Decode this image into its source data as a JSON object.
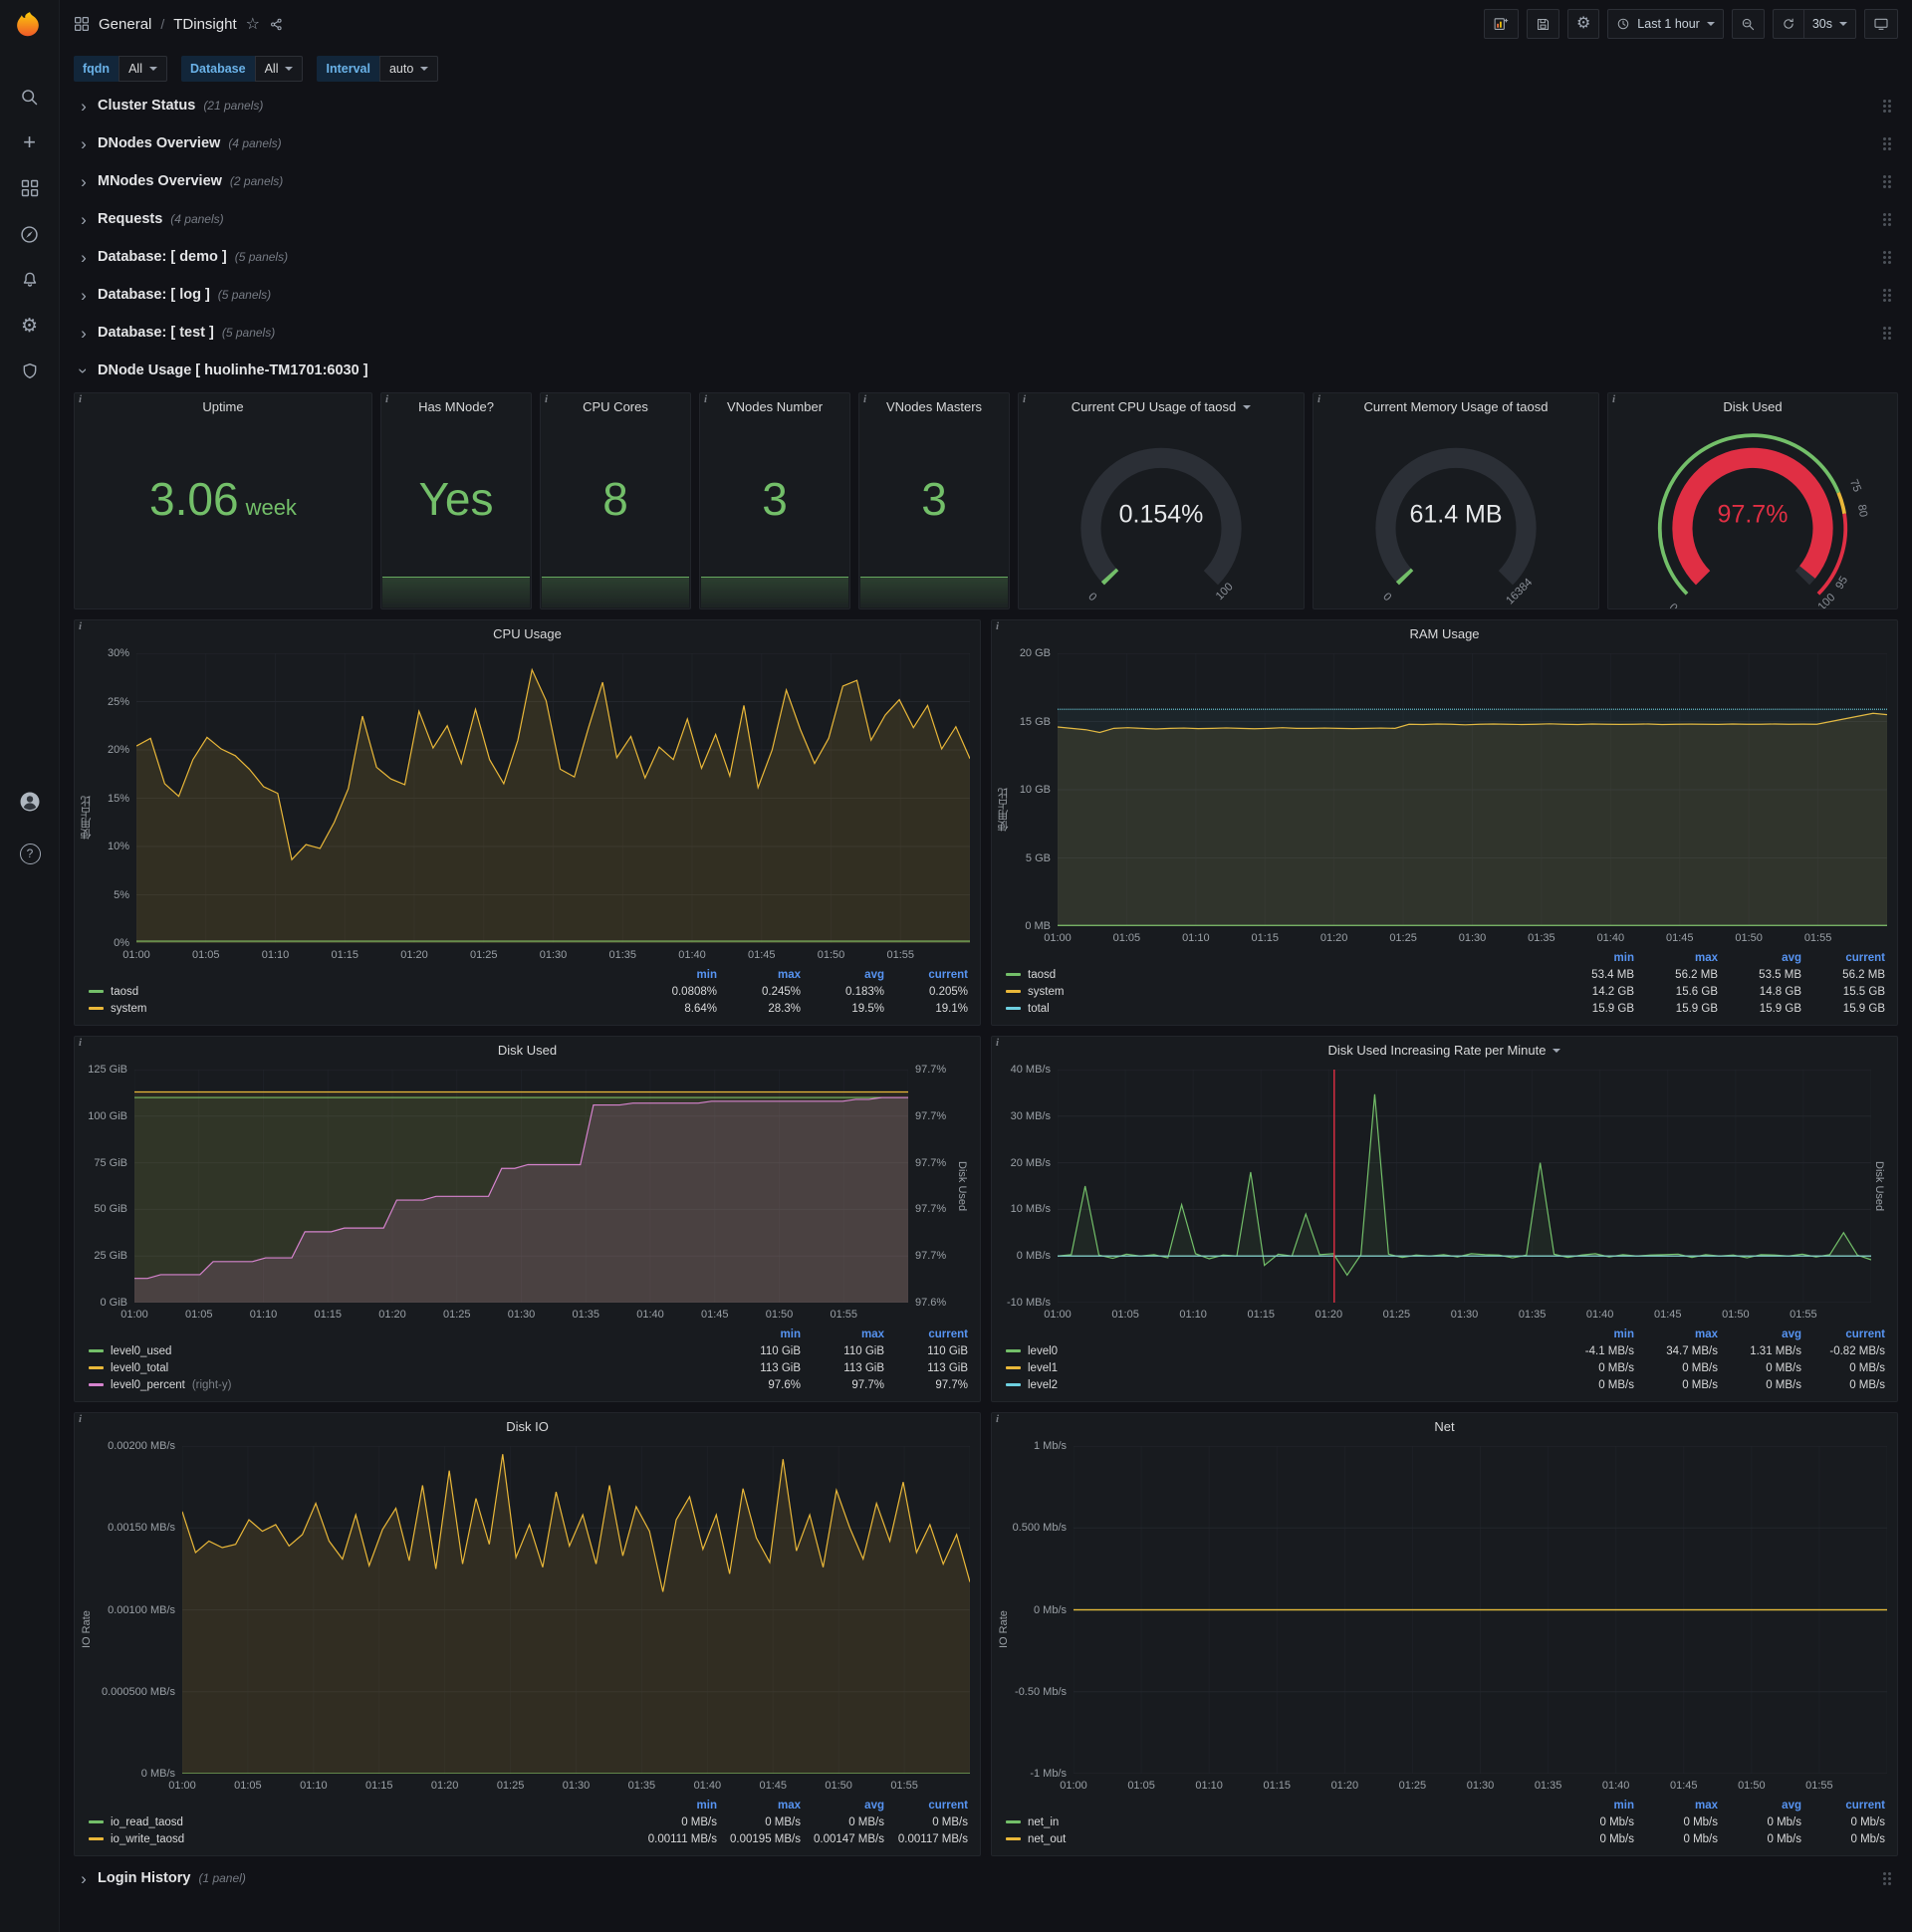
{
  "theme": {
    "page_bg": "#111217",
    "panel_bg": "#181b1f",
    "green": "#73bf69",
    "yellow": "#eab839",
    "cyan": "#6ed0e0",
    "pink": "#d683ce",
    "red": "#e02f44",
    "legend_header_blue": "#5794f2",
    "variable_label_blue": "#6ab2e8"
  },
  "icons": {
    "gear": "⚙",
    "star": "☆",
    "plus": "+",
    "help": "?",
    "chevron": "›",
    "info": "i"
  },
  "nav": {
    "section": "General",
    "separator": "/",
    "page": "TDinsight",
    "time_range": "Last 1 hour",
    "refresh_interval": "30s"
  },
  "variables": [
    {
      "label": "fqdn",
      "value": "All"
    },
    {
      "label": "Database",
      "value": "All"
    },
    {
      "label": "Interval",
      "value": "auto"
    }
  ],
  "rows": [
    {
      "title": "Cluster Status",
      "count": "(21 panels)"
    },
    {
      "title": "DNodes Overview",
      "count": "(4 panels)"
    },
    {
      "title": "MNodes Overview",
      "count": "(2 panels)"
    },
    {
      "title": "Requests",
      "count": "(4 panels)"
    },
    {
      "title": "Database: [ demo ]",
      "count": "(5 panels)"
    },
    {
      "title": "Database: [ log ]",
      "count": "(5 panels)"
    },
    {
      "title": "Database: [ test ]",
      "count": "(5 panels)"
    }
  ],
  "expanded_row": {
    "title": "DNode Usage [ huolinhe-TM1701:6030 ]"
  },
  "login_row": {
    "title": "Login History",
    "count": "(1 panel)"
  },
  "time_ticks": [
    "01:00",
    "01:05",
    "01:10",
    "01:15",
    "01:20",
    "01:25",
    "01:30",
    "01:35",
    "01:40",
    "01:45",
    "01:50",
    "01:55"
  ],
  "stats": [
    {
      "type": "stat",
      "title": "Uptime",
      "value": "3.06",
      "unit": "week",
      "spark": false
    },
    {
      "type": "stat",
      "title": "Has MNode?",
      "value": "Yes",
      "spark": true
    },
    {
      "type": "stat",
      "title": "CPU Cores",
      "value": "8",
      "spark": true
    },
    {
      "type": "stat",
      "title": "VNodes Number",
      "value": "3",
      "spark": true
    },
    {
      "type": "stat",
      "title": "VNodes Masters",
      "value": "3",
      "spark": true
    },
    {
      "type": "gauge",
      "title": "Current CPU Usage of taosd",
      "caret": true,
      "value": "0.154%",
      "frac": 0.0015,
      "color": "#73bf69",
      "labels": [
        {
          "text": "0",
          "f": 0
        },
        {
          "text": "100",
          "f": 1
        }
      ]
    },
    {
      "type": "gauge",
      "title": "Current Memory Usage of taosd",
      "value": "61.4 MB",
      "frac": 0.0037,
      "color": "#73bf69",
      "labels": [
        {
          "text": "0",
          "f": 0
        },
        {
          "text": "16384",
          "f": 1
        }
      ]
    },
    {
      "type": "gauge",
      "title": "Disk Used",
      "value": "97.7%",
      "frac": 0.977,
      "color": "#e02f44",
      "value_color": "#e02f44",
      "labels": [
        {
          "text": "0",
          "f": 0
        },
        {
          "text": "75",
          "f": 0.75
        },
        {
          "text": "80",
          "f": 0.8
        },
        {
          "text": "95",
          "f": 0.95
        },
        {
          "text": "100",
          "f": 1
        }
      ],
      "ring": [
        {
          "from": 0,
          "to": 0.75,
          "color": "#73bf69"
        },
        {
          "from": 0.75,
          "to": 0.8,
          "color": "#eab839"
        },
        {
          "from": 0.8,
          "to": 1,
          "color": "#e02f44"
        }
      ]
    }
  ],
  "charts": [
    {
      "type": "line",
      "title": "CPU Usage",
      "y_label": "使用占比",
      "ymin": 0,
      "ymax": 30,
      "y_ticks": [
        "30%",
        "25%",
        "20%",
        "15%",
        "10%",
        "5%",
        "0%"
      ],
      "legend_cols": [
        "min",
        "max",
        "avg",
        "current"
      ],
      "series": [
        {
          "name": "taosd",
          "color": "#73bf69",
          "fill": true,
          "fill_opacity": 0.08,
          "values": [
            0.2,
            0.2
          ],
          "legend": [
            "0.0808%",
            "0.245%",
            "0.183%",
            "0.205%"
          ]
        },
        {
          "name": "system",
          "color": "#eab839",
          "fill": true,
          "fill_opacity": 0.13,
          "values": [
            20.4,
            21.2,
            16.5,
            15.2,
            19.0,
            21.3,
            20.1,
            19.4,
            18.0,
            16.2,
            15.5,
            8.64,
            10.2,
            9.8,
            12.5,
            16.0,
            23.5,
            18.2,
            17.0,
            16.4,
            24.0,
            20.2,
            22.5,
            18.6,
            24.2,
            19.0,
            16.5,
            21.0,
            28.3,
            25.1,
            18.0,
            17.2,
            22.3,
            27.0,
            19.2,
            21.4,
            17.1,
            20.3,
            19.0,
            23.2,
            18.1,
            21.6,
            17.3,
            24.6,
            16.1,
            20.0,
            26.2,
            22.1,
            18.6,
            21.2,
            26.6,
            27.2,
            21.0,
            23.6,
            25.2,
            22.3,
            24.6,
            20.1,
            22.4,
            19.1
          ],
          "legend": [
            "8.64%",
            "28.3%",
            "19.5%",
            "19.1%"
          ]
        }
      ]
    },
    {
      "type": "line",
      "title": "RAM Usage",
      "y_label": "使用占比",
      "ymin": 0,
      "ymax": 20,
      "y_ticks": [
        "20 GB",
        "15 GB",
        "10 GB",
        "5 GB",
        "0 MB"
      ],
      "legend_cols": [
        "min",
        "max",
        "avg",
        "current"
      ],
      "series": [
        {
          "name": "taosd",
          "color": "#73bf69",
          "fill": true,
          "fill_opacity": 0.08,
          "values": [
            0.053,
            0.053
          ],
          "legend": [
            "53.4 MB",
            "56.2 MB",
            "53.5 MB",
            "56.2 MB"
          ]
        },
        {
          "name": "system",
          "color": "#eab839",
          "fill": true,
          "fill_opacity": 0.1,
          "values": [
            14.6,
            14.5,
            14.4,
            14.2,
            14.5,
            14.55,
            14.5,
            14.45,
            14.5,
            14.52,
            14.48,
            14.5,
            14.53,
            14.5,
            14.47,
            14.5,
            14.55,
            14.5,
            14.5,
            14.52,
            14.5,
            14.48,
            14.5,
            14.52,
            14.5,
            14.8,
            14.78,
            14.82,
            14.8,
            14.76,
            14.8,
            14.82,
            14.8,
            14.78,
            14.8,
            14.83,
            14.8,
            14.78,
            14.82,
            14.8,
            14.79,
            14.8,
            14.82,
            14.78,
            14.8,
            14.81,
            14.8,
            14.79,
            14.82,
            14.8,
            14.8,
            14.82,
            14.8,
            14.81,
            14.8,
            15.0,
            15.2,
            15.4,
            15.6,
            15.5
          ],
          "legend": [
            "14.2 GB",
            "15.6 GB",
            "14.8 GB",
            "15.5 GB"
          ]
        },
        {
          "name": "total",
          "color": "#6ed0e0",
          "fill": true,
          "fill_opacity": 0.06,
          "dash": true,
          "values": [
            15.9,
            15.9
          ],
          "legend": [
            "15.9 GB",
            "15.9 GB",
            "15.9 GB",
            "15.9 GB"
          ]
        }
      ]
    },
    {
      "type": "line",
      "title": "Disk Used",
      "ymin": 0,
      "ymax": 125,
      "y_ticks": [
        "125 GiB",
        "100 GiB",
        "75 GiB",
        "50 GiB",
        "25 GiB",
        "0 GiB"
      ],
      "right_ticks": [
        "97.7%",
        "97.7%",
        "97.7%",
        "97.7%",
        "97.7%",
        "97.6%"
      ],
      "right_label": "Disk Used",
      "legend_cols": [
        "min",
        "max",
        "current"
      ],
      "series": [
        {
          "name": "level0_used",
          "color": "#73bf69",
          "fill": true,
          "fill_opacity": 0.1,
          "values": [
            110,
            110
          ],
          "legend": [
            "110 GiB",
            "110 GiB",
            "110 GiB"
          ]
        },
        {
          "name": "level0_total",
          "color": "#eab839",
          "fill": true,
          "fill_opacity": 0.08,
          "values": [
            113,
            113
          ],
          "legend": [
            "113 GiB",
            "113 GiB",
            "113 GiB"
          ]
        },
        {
          "name": "level0_percent",
          "note": "(right-y)",
          "color": "#d683ce",
          "fill": true,
          "fill_opacity": 0.16,
          "values": [
            13,
            13,
            15,
            15,
            15,
            15,
            22,
            22,
            22,
            22,
            24,
            24,
            24,
            38,
            38,
            38,
            40,
            40,
            40,
            40,
            55,
            55,
            55,
            57,
            57,
            57,
            57,
            57,
            72,
            72,
            74,
            74,
            74,
            74,
            74,
            106,
            106,
            106,
            107,
            107,
            107,
            107,
            107,
            107,
            108,
            108,
            108,
            108,
            108,
            108,
            108,
            108,
            108,
            108,
            108,
            109,
            109,
            110,
            110,
            110
          ],
          "legend": [
            "97.6%",
            "97.7%",
            "97.7%"
          ]
        }
      ]
    },
    {
      "type": "line",
      "title": "Disk Used Increasing Rate per Minute",
      "caret": true,
      "ymin": -10,
      "ymax": 40,
      "y_ticks": [
        "40 MB/s",
        "30 MB/s",
        "20 MB/s",
        "10 MB/s",
        "0 MB/s",
        "-10 MB/s"
      ],
      "right_label": "Disk Used",
      "annotation": {
        "x_frac": 0.34,
        "color": "#e02f44"
      },
      "legend_cols": [
        "min",
        "max",
        "avg",
        "current"
      ],
      "series": [
        {
          "name": "level0",
          "color": "#73bf69",
          "fill": true,
          "fill_opacity": 0.08,
          "values": [
            0,
            0.3,
            15,
            0.2,
            -0.5,
            0.4,
            0,
            0.3,
            -0.4,
            11,
            0.5,
            -0.6,
            0.2,
            0,
            18,
            -2,
            0.4,
            0,
            9,
            0.3,
            0.5,
            -4.1,
            0.3,
            34.7,
            0.4,
            -0.3,
            0.2,
            0,
            0.3,
            -0.2,
            0.5,
            0.3,
            0.2,
            -0.4,
            0.2,
            20,
            0.4,
            -0.3,
            0.2,
            0.5,
            -0.2,
            0.3,
            0,
            0.2,
            0.3,
            0.4,
            -0.3,
            0.3,
            0,
            0.2,
            -0.4,
            0.3,
            0.2,
            0,
            0.4,
            -0.2,
            0.3,
            5,
            0.2,
            -0.82
          ],
          "legend": [
            "-4.1 MB/s",
            "34.7 MB/s",
            "1.31 MB/s",
            "-0.82 MB/s"
          ]
        },
        {
          "name": "level1",
          "color": "#eab839",
          "fill": false,
          "values": [
            0,
            0
          ],
          "legend": [
            "0 MB/s",
            "0 MB/s",
            "0 MB/s",
            "0 MB/s"
          ]
        },
        {
          "name": "level2",
          "color": "#6ed0e0",
          "fill": false,
          "values": [
            0,
            0
          ],
          "legend": [
            "0 MB/s",
            "0 MB/s",
            "0 MB/s",
            "0 MB/s"
          ]
        }
      ]
    },
    {
      "type": "line",
      "title": "Disk IO",
      "y_label": "IO Rate",
      "ymin": 0,
      "ymax": 0.002,
      "y_ticks": [
        "0.00200 MB/s",
        "0.00150 MB/s",
        "0.00100 MB/s",
        "0.000500 MB/s",
        "0 MB/s"
      ],
      "legend_cols": [
        "min",
        "max",
        "avg",
        "current"
      ],
      "series": [
        {
          "name": "io_read_taosd",
          "color": "#73bf69",
          "fill": false,
          "values": [
            0,
            0
          ],
          "legend": [
            "0 MB/s",
            "0 MB/s",
            "0 MB/s",
            "0 MB/s"
          ]
        },
        {
          "name": "io_write_taosd",
          "color": "#eab839",
          "fill": true,
          "fill_opacity": 0.12,
          "values": [
            0.0016,
            0.00135,
            0.00142,
            0.00138,
            0.0014,
            0.00155,
            0.00148,
            0.00152,
            0.00139,
            0.00146,
            0.00165,
            0.00142,
            0.00131,
            0.00158,
            0.00127,
            0.00149,
            0.00162,
            0.0013,
            0.00176,
            0.00125,
            0.00185,
            0.00128,
            0.00168,
            0.0014,
            0.00195,
            0.00132,
            0.00152,
            0.00126,
            0.00172,
            0.00139,
            0.00158,
            0.00128,
            0.00176,
            0.00133,
            0.00163,
            0.00148,
            0.00111,
            0.00155,
            0.00169,
            0.00137,
            0.00158,
            0.00122,
            0.00174,
            0.00144,
            0.00129,
            0.00192,
            0.00136,
            0.00158,
            0.00126,
            0.00173,
            0.0015,
            0.00131,
            0.00165,
            0.00142,
            0.00178,
            0.00135,
            0.00152,
            0.00128,
            0.00146,
            0.00117
          ],
          "legend": [
            "0.00111 MB/s",
            "0.00195 MB/s",
            "0.00147 MB/s",
            "0.00117 MB/s"
          ]
        }
      ]
    },
    {
      "type": "line",
      "title": "Net",
      "y_label": "IO Rate",
      "ymin": -1,
      "ymax": 1,
      "y_ticks": [
        "1 Mb/s",
        "0.500 Mb/s",
        "0 Mb/s",
        "-0.50 Mb/s",
        "-1 Mb/s"
      ],
      "legend_cols": [
        "min",
        "max",
        "avg",
        "current"
      ],
      "series": [
        {
          "name": "net_in",
          "color": "#73bf69",
          "fill": false,
          "values": [
            0,
            0
          ],
          "legend": [
            "0 Mb/s",
            "0 Mb/s",
            "0 Mb/s",
            "0 Mb/s"
          ]
        },
        {
          "name": "net_out",
          "color": "#eab839",
          "fill": false,
          "values": [
            0,
            0
          ],
          "legend": [
            "0 Mb/s",
            "0 Mb/s",
            "0 Mb/s",
            "0 Mb/s"
          ]
        }
      ]
    }
  ]
}
